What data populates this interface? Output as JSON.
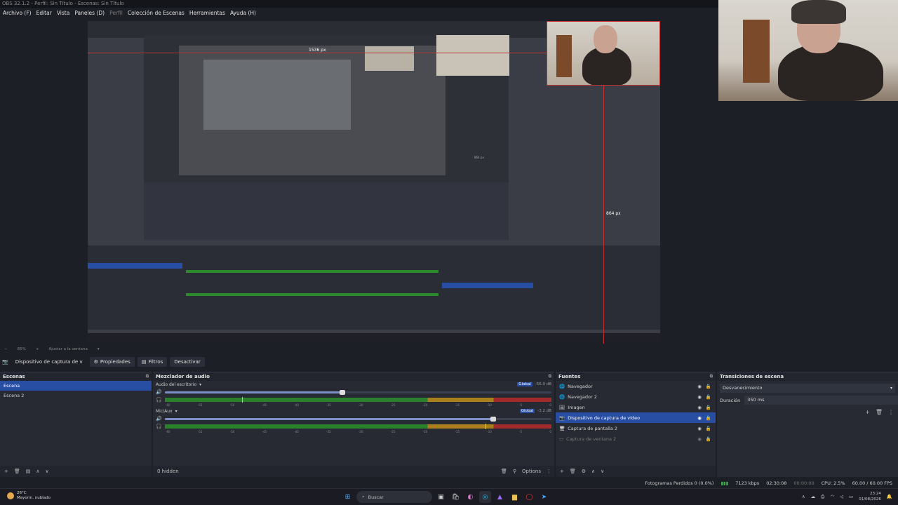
{
  "window": {
    "title": "OBS 32.1.2 - Perfil: Sin Título - Escenas: Sin Título"
  },
  "menu": [
    "Archivo (F)",
    "Editar",
    "Vista",
    "Paneles (D)",
    "Perfil",
    "Colección de Escenas",
    "Herramientas",
    "Ayuda (H)"
  ],
  "preview": {
    "measure_width": "1536 px",
    "measure_height": "864 px",
    "measure_small": "864 px"
  },
  "zoom": {
    "label": "85%",
    "fit": "Ajustar a la ventana"
  },
  "source_toolbar": {
    "source_name": "Dispositivo de captura de v",
    "properties": "Propiedades",
    "filters": "Filtros",
    "deactivate": "Desactivar"
  },
  "scenes": {
    "title": "Escenas",
    "items": [
      "Escena",
      "Escena 2"
    ],
    "active_index": 0
  },
  "mixer": {
    "title": "Mezclador de audio",
    "tracks": [
      {
        "name": "Audio del escritorio",
        "global": "Global",
        "db": "-56.0 dB",
        "volume": 0.46,
        "level": 0.2
      },
      {
        "name": "Mic/Aux",
        "global": "Global",
        "db": "-3.2 dB",
        "volume": 0.85,
        "level": 0.83
      }
    ],
    "scale": [
      "-60",
      "-55",
      "-50",
      "-45",
      "-40",
      "-35",
      "-30",
      "-25",
      "-20",
      "-15",
      "-10",
      "-5",
      "0"
    ],
    "hidden": "0 hidden",
    "options": "Options"
  },
  "sources": {
    "title": "Fuentes",
    "items": [
      {
        "name": "Navegador",
        "icon": "globe-icon",
        "dim": false
      },
      {
        "name": "Navegador 2",
        "icon": "globe-icon",
        "dim": false
      },
      {
        "name": "Imagen",
        "icon": "image-icon",
        "dim": false
      },
      {
        "name": "Dispositivo de captura de vídeo",
        "icon": "camera-icon",
        "dim": false,
        "active": true
      },
      {
        "name": "Captura de pantalla 2",
        "icon": "monitor-icon",
        "dim": false
      },
      {
        "name": "Captura de ventana 2",
        "icon": "window-icon",
        "dim": true
      }
    ]
  },
  "transitions": {
    "title": "Transiciones de escena",
    "type": "Desvanecimiento",
    "duration_label": "Duración",
    "duration": "350 ms"
  },
  "status": {
    "dropped": "Fotogramas Perdidos 0 (0.0%)",
    "bitrate": "7123 kbps",
    "stream_time": "02:30:08",
    "rec_time": "00:00:00",
    "cpu": "CPU: 2.5%",
    "fps": "60.00 / 60.00 FPS"
  },
  "taskbar": {
    "weather_temp": "26°C",
    "weather_desc": "Mayorm. nublado",
    "search": "Buscar",
    "time": "23:24",
    "date": "01/08/2026"
  }
}
